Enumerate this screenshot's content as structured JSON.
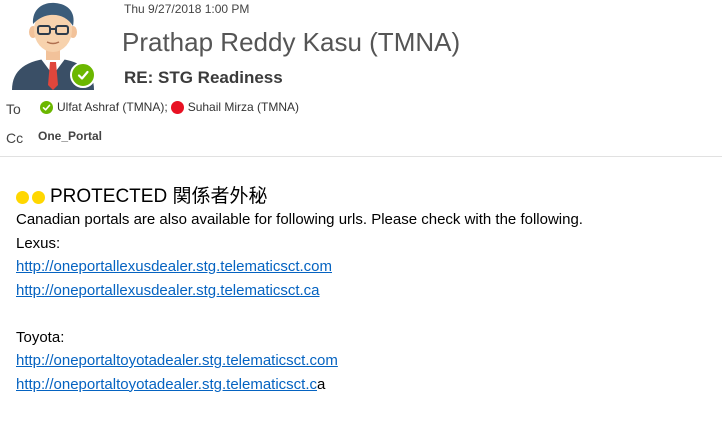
{
  "header": {
    "timestamp": "Thu 9/27/2018 1:00 PM",
    "sender": "Prathap Reddy Kasu (TMNA)",
    "subject": "RE: STG Readiness",
    "to_label": "To",
    "cc_label": "Cc",
    "recipients": [
      {
        "name": "Ulfat Ashraf (TMNA);",
        "status": "available"
      },
      {
        "name": "Suhail Mirza (TMNA)",
        "status": "busy"
      }
    ],
    "cc": "One_Portal"
  },
  "body": {
    "protected_label": "PROTECTED 関係者外秘",
    "intro": "Canadian portals are also available for following urls. Please check with the following.",
    "lexus_label": "Lexus:",
    "lexus_link_1": "http://oneportallexusdealer.stg.telematicsct.com",
    "lexus_link_2": "http://oneportallexusdealer.stg.telematicsct.ca",
    "toyota_label": "Toyota:",
    "toyota_link_1": "http://oneportaltoyotadealer.stg.telematicsct.com",
    "toyota_link_2_linked": "http://oneportaltoyotadealer.stg.telematicsct.c",
    "toyota_link_2_tail": "a"
  },
  "colors": {
    "link": "#0563c1",
    "presence_available": "#6bb700",
    "presence_busy": "#e81123",
    "protected_dots": "#ffd700"
  }
}
